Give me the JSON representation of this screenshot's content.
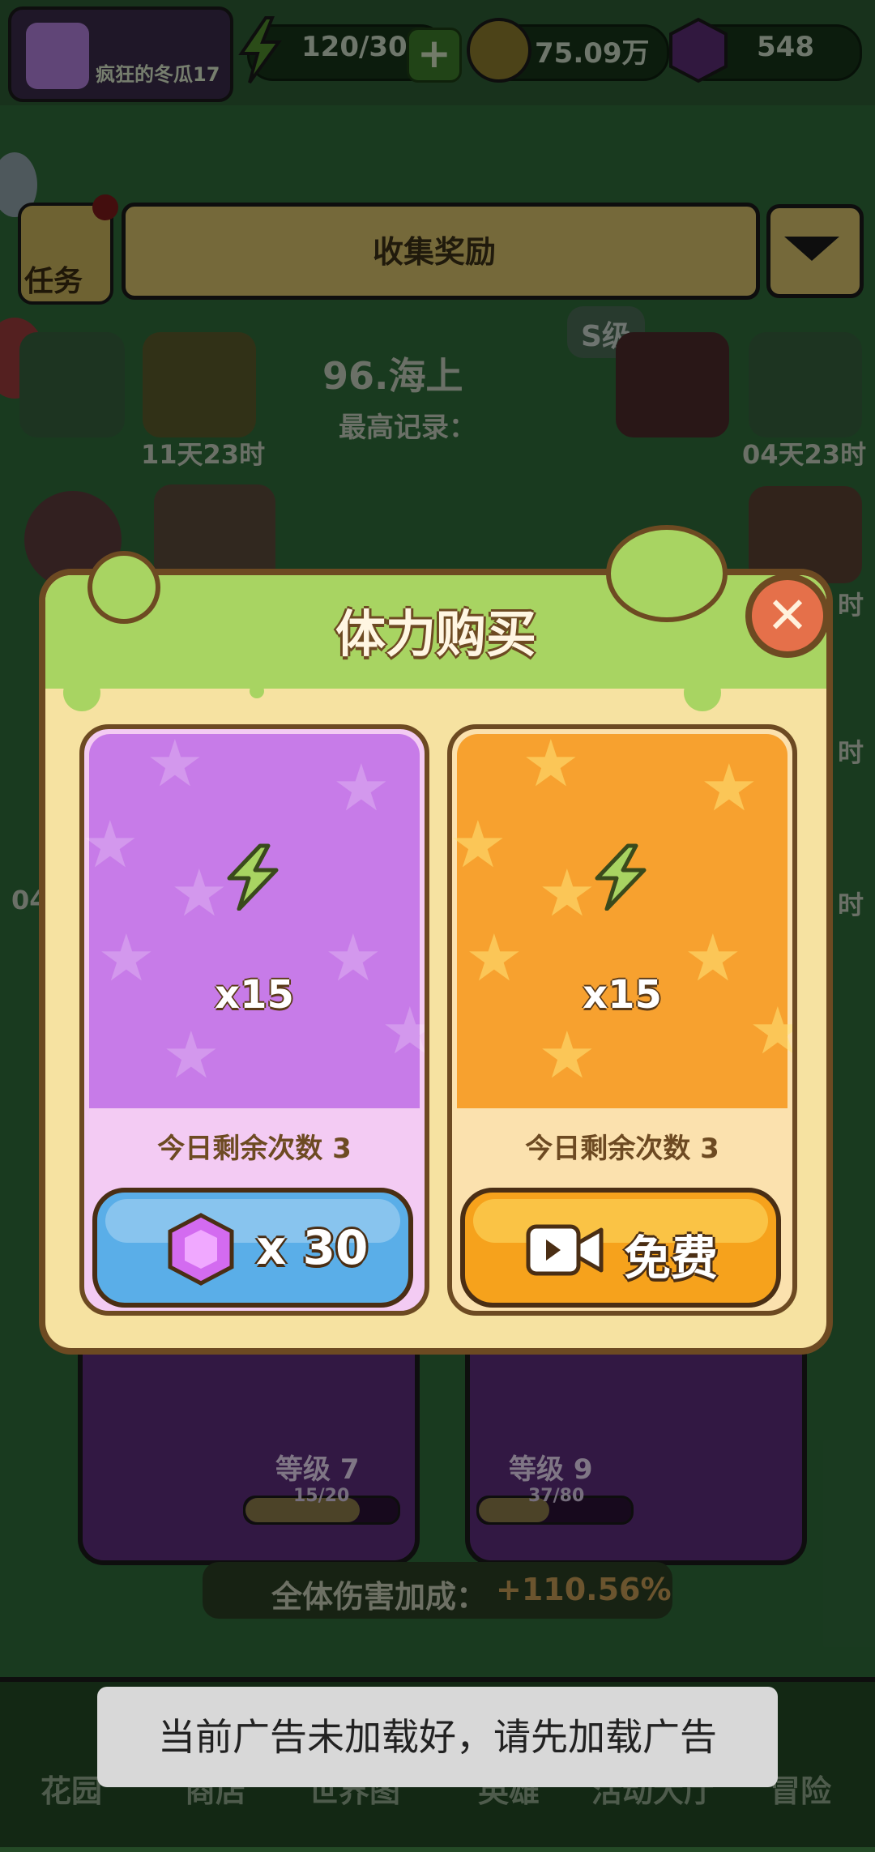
{
  "hud": {
    "player_name": "疯狂的冬瓜17",
    "energy": "120/30",
    "coins": "75.09万",
    "gems": "548"
  },
  "menu": {
    "task_label": "任务",
    "collect_reward": "收集奖励",
    "level_title": "96.海上",
    "best_record": "最高记录：",
    "rank_badge": "S级",
    "timer_left": "11天23时",
    "timer_right": "04天23时",
    "side_timer_a": "时",
    "side_timer_b": "时",
    "side_timer_c": "时",
    "side_num": "04"
  },
  "modal": {
    "title": "体力购买",
    "offers": [
      {
        "quantity": "x15",
        "remaining": "今日剩余次数 3",
        "button_label": "x 30",
        "button_icon": "gem-icon",
        "theme": "#c77be8"
      },
      {
        "quantity": "x15",
        "remaining": "今日剩余次数 3",
        "button_label": "免费",
        "button_icon": "video-icon",
        "theme": "#f7a12f"
      }
    ]
  },
  "cards": [
    {
      "level": "等级 7",
      "xp": "15/20",
      "xp_fraction": 0.75
    },
    {
      "level": "等级 9",
      "xp": "37/80",
      "xp_fraction": 0.4625
    }
  ],
  "bonus": {
    "label": "全体伤害加成：",
    "value": "+110.56%"
  },
  "nav": {
    "items": [
      "花园",
      "商店",
      "世界图",
      "英雄",
      "活动大厅",
      "冒险"
    ]
  },
  "toast": {
    "message": "当前广告未加载好，请先加载广告"
  },
  "colors": {
    "energy_green": "#a8d462",
    "gem_purple": "#b04fd8",
    "coin_gold": "#c9a23a",
    "button_blue": "#5aaee8",
    "button_orange": "#f6a21c",
    "close_red": "#e5704a"
  }
}
